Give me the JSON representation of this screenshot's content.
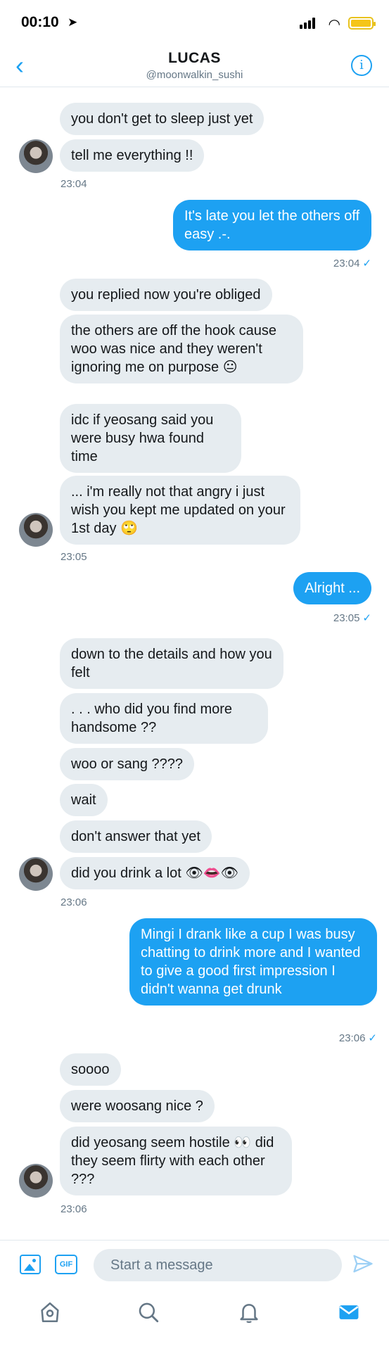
{
  "status_bar": {
    "time": "00:10",
    "location_icon": "location-arrow-icon",
    "battery_color": "#f5c518"
  },
  "header": {
    "back_icon": "chevron-left-icon",
    "name": "LUCAS",
    "handle": "@moonwalkin_sushi",
    "info_icon": "info-icon"
  },
  "messages": [
    {
      "side": "in",
      "text": "you don't get to sleep just yet"
    },
    {
      "side": "in",
      "text": "tell me everything !!"
    },
    {
      "side": "ts",
      "text": "23:04"
    },
    {
      "side": "out",
      "text": "It's late you let the others off easy .-."
    },
    {
      "side": "ts_out",
      "text": "23:04"
    },
    {
      "side": "in",
      "text": "you replied now you're obliged"
    },
    {
      "side": "in",
      "text": "the others are off the hook cause woo was nice and they weren't ignoring me on purpose 😐"
    },
    {
      "side": "in",
      "text": "idc if yeosang said you were busy hwa found time"
    },
    {
      "side": "in",
      "text": "... i'm really not that angry i just wish you kept me updated on your 1st day 🙄"
    },
    {
      "side": "ts",
      "text": "23:05"
    },
    {
      "side": "out",
      "text": "Alright ..."
    },
    {
      "side": "ts_out",
      "text": "23:05"
    },
    {
      "side": "in",
      "text": "down to the details and how you felt"
    },
    {
      "side": "in",
      "text": ". . . who did you find more handsome ??"
    },
    {
      "side": "in",
      "text": "woo or sang ????"
    },
    {
      "side": "in",
      "text": "wait"
    },
    {
      "side": "in",
      "text": "don't answer that yet"
    },
    {
      "side": "in",
      "text": "did you drink a lot 👁👄👁"
    },
    {
      "side": "ts",
      "text": "23:06"
    },
    {
      "side": "out",
      "text": "Mingi I drank like a cup I was busy chatting to drink more and I wanted to give a good first impression I didn't wanna get drunk"
    },
    {
      "side": "ts_out",
      "text": "23:06"
    },
    {
      "side": "in",
      "text": "soooo"
    },
    {
      "side": "in",
      "text": "were woosang nice ?"
    },
    {
      "side": "in",
      "text": "did yeosang seem hostile 👀 did they seem flirty with each other ???"
    },
    {
      "side": "ts",
      "text": "23:06"
    }
  ],
  "composer": {
    "placeholder": "Start a message",
    "gif_label": "GIF",
    "image_icon": "image-icon",
    "send_icon": "send-icon"
  },
  "tabbar": {
    "items": [
      "home-icon",
      "search-icon",
      "notifications-icon",
      "messages-icon"
    ]
  },
  "colors": {
    "accent": "#1da1f2",
    "incoming_bubble": "#e6ecf0",
    "muted": "#657786"
  }
}
